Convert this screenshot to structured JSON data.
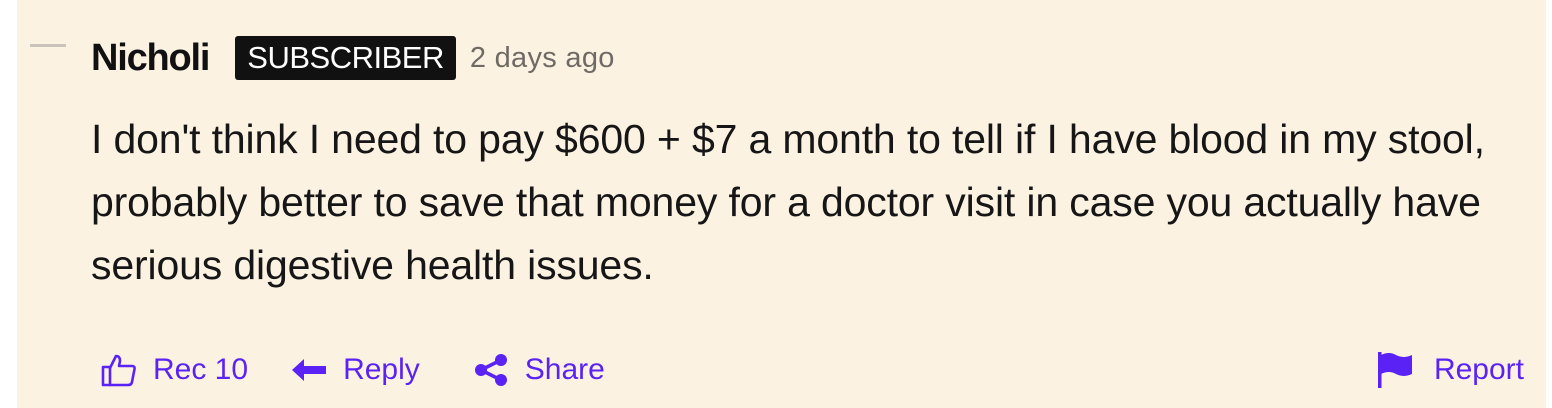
{
  "comment": {
    "author": "Nicholi",
    "badge": "SUBSCRIBER",
    "timestamp": "2 days ago",
    "body": "I don't think I need to pay $600 + $7 a month to tell if I have blood in my stool, probably better to save that money for a doctor visit in case you actually have serious digestive health issues."
  },
  "actions": {
    "rec_label": "Rec 10",
    "reply_label": "Reply",
    "share_label": "Share",
    "report_label": "Report"
  },
  "icons": {
    "collapse": "collapse-icon",
    "rec": "thumbs-up-icon",
    "reply": "reply-arrow-icon",
    "share": "share-icon",
    "report": "flag-icon"
  },
  "colors": {
    "background": "#fcf2e2",
    "accent": "#5a22f5",
    "text": "#161616",
    "badge_bg": "#111111",
    "muted": "#6f6a65"
  }
}
